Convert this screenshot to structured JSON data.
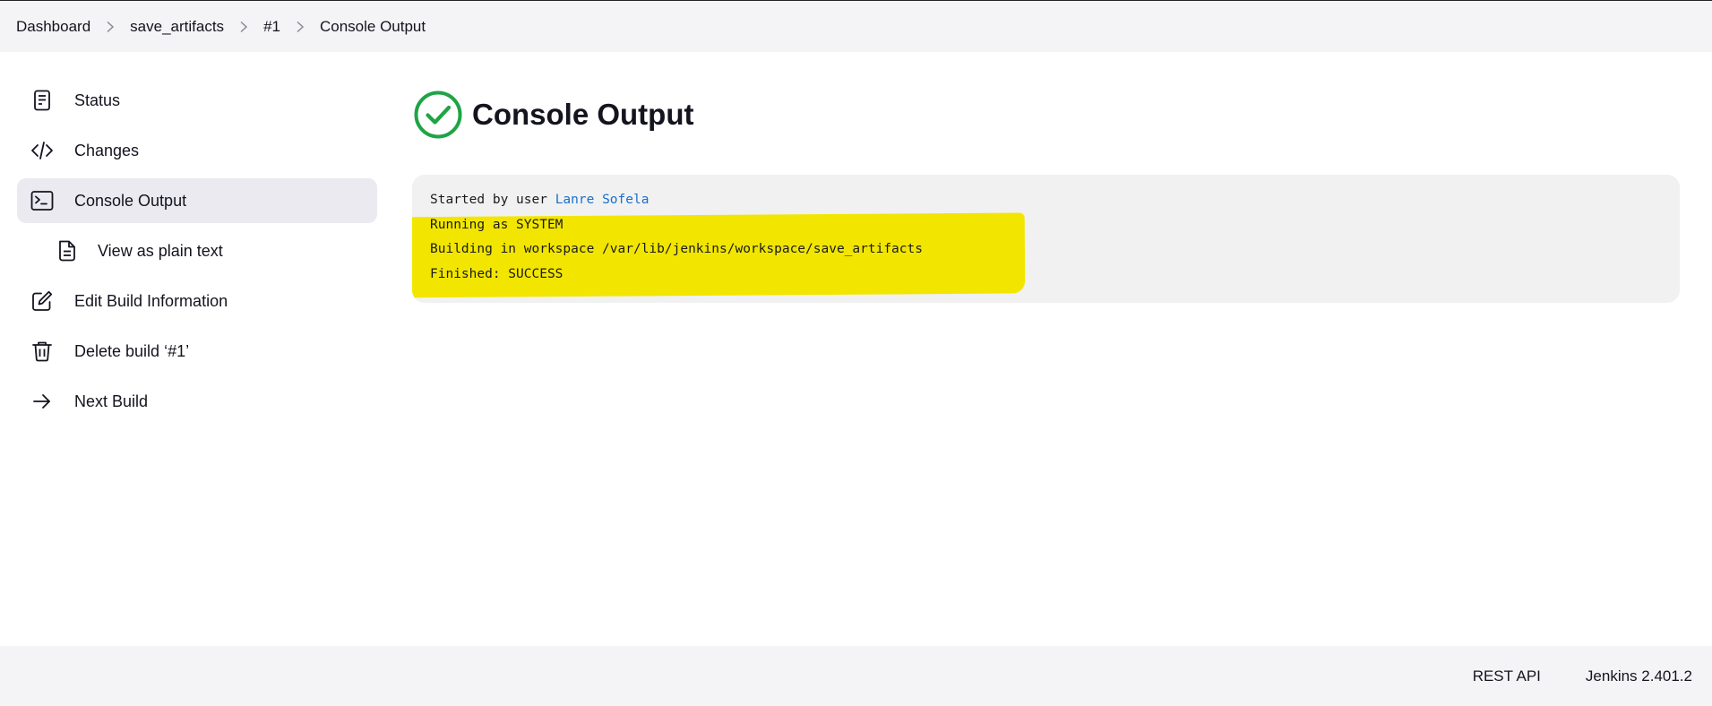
{
  "breadcrumb": {
    "items": [
      {
        "label": "Dashboard"
      },
      {
        "label": "save_artifacts"
      },
      {
        "label": "#1"
      },
      {
        "label": "Console Output"
      }
    ]
  },
  "sidebar": {
    "items": [
      {
        "label": "Status",
        "icon": "document-icon"
      },
      {
        "label": "Changes",
        "icon": "code-icon"
      },
      {
        "label": "Console Output",
        "icon": "terminal-icon",
        "active": true
      },
      {
        "label": "View as plain text",
        "icon": "file-text-icon"
      },
      {
        "label": "Edit Build Information",
        "icon": "edit-icon"
      },
      {
        "label": "Delete build ‘#1’",
        "icon": "trash-icon"
      },
      {
        "label": "Next Build",
        "icon": "arrow-right-icon"
      }
    ]
  },
  "main": {
    "title": "Console Output",
    "status_icon": "success-check-icon",
    "status_color": "#1ea446"
  },
  "console": {
    "line1_prefix": "Started by user ",
    "line1_user": "Lanre Sofela",
    "line2": "Running as SYSTEM",
    "line3": "Building in workspace /var/lib/jenkins/workspace/save_artifacts",
    "line4": "Finished: SUCCESS",
    "highlight_color": "#f2e600"
  },
  "footer": {
    "rest_api": "REST API",
    "version": "Jenkins 2.401.2"
  }
}
